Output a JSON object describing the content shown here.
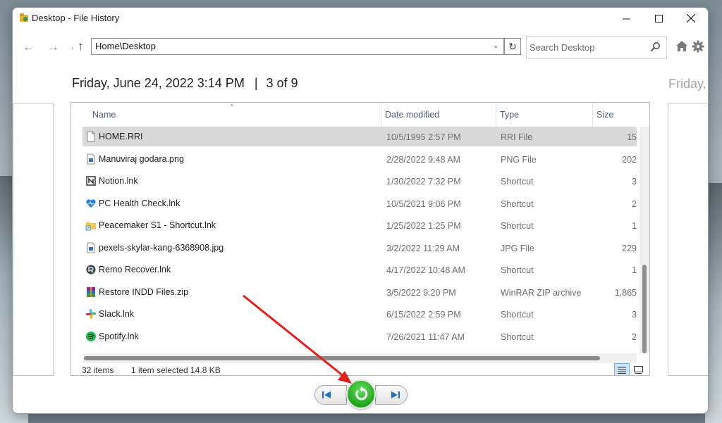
{
  "window": {
    "title": "Desktop - File History"
  },
  "nav": {
    "address": "Home\\Desktop",
    "search_placeholder": "Search Desktop"
  },
  "snapshot": {
    "date": "Friday, June 24, 2022 3:14 PM",
    "separator": "|",
    "position": "3 of 9",
    "next_date_peek": "Friday,"
  },
  "columns": {
    "name": "Name",
    "date_modified": "Date modified",
    "type": "Type",
    "size": "Size"
  },
  "files": [
    {
      "name": "HOME.RRI",
      "date": "10/5/1995 2:57 PM",
      "type": "RRI File",
      "size": "15",
      "icon": "file-icon",
      "selected": true
    },
    {
      "name": "Manuviraj godara.png",
      "date": "2/28/2022 9:48 AM",
      "type": "PNG File",
      "size": "202",
      "icon": "image-file-icon"
    },
    {
      "name": "Notion.lnk",
      "date": "1/30/2022 7:32 PM",
      "type": "Shortcut",
      "size": "3",
      "icon": "notion-icon"
    },
    {
      "name": "PC Health Check.lnk",
      "date": "10/5/2021 9:06 PM",
      "type": "Shortcut",
      "size": "2",
      "icon": "heart-icon"
    },
    {
      "name": "Peacemaker S1 - Shortcut.lnk",
      "date": "1/25/2022 1:25 PM",
      "type": "Shortcut",
      "size": "1",
      "icon": "folder-shortcut-icon"
    },
    {
      "name": "pexels-skylar-kang-6368908.jpg",
      "date": "3/2/2022 11:29 AM",
      "type": "JPG File",
      "size": "229",
      "icon": "image-file-icon"
    },
    {
      "name": "Remo Recover.lnk",
      "date": "4/17/2022 10:48 AM",
      "type": "Shortcut",
      "size": "1",
      "icon": "remo-icon"
    },
    {
      "name": "Restore INDD Files.zip",
      "date": "3/5/2022 9:20 PM",
      "type": "WinRAR ZIP archive",
      "size": "1,865",
      "icon": "winrar-icon"
    },
    {
      "name": "Slack.lnk",
      "date": "6/15/2022 2:59 PM",
      "type": "Shortcut",
      "size": "3",
      "icon": "slack-icon"
    },
    {
      "name": "Spotify.lnk",
      "date": "7/26/2021 11:47 AM",
      "type": "Shortcut",
      "size": "2",
      "icon": "spotify-icon"
    }
  ],
  "status": {
    "items": "32 items",
    "selected": "1 item selected  14.8 KB"
  },
  "colors": {
    "restore_green": "#22a41d",
    "selection_gray": "#d9d9d9",
    "annotation_red": "#e0201b",
    "playback_blue": "#1f6fc6"
  }
}
